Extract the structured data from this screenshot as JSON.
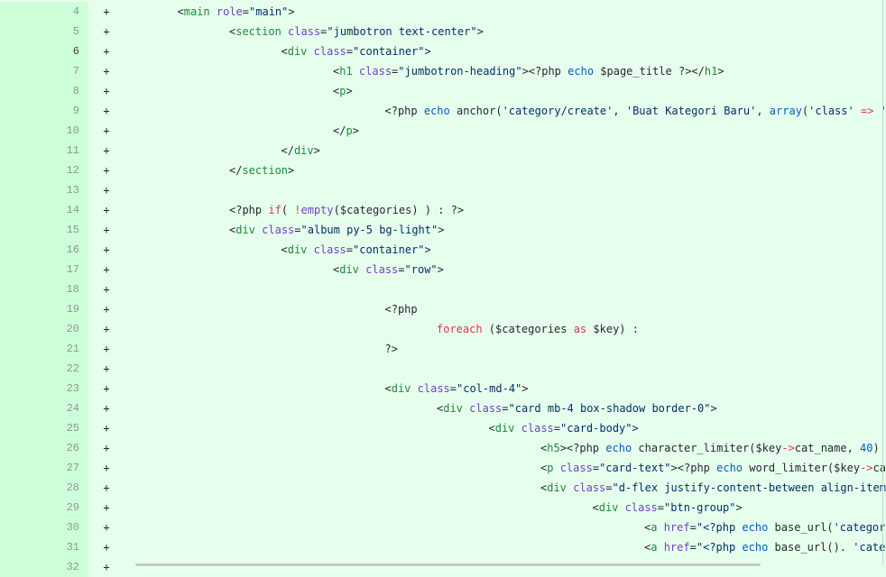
{
  "diff": {
    "lines": [
      {
        "num": "4",
        "marker": "+",
        "indent": 1,
        "tokens": [
          {
            "t": "<",
            "c": "text"
          },
          {
            "t": "main",
            "c": "tag"
          },
          {
            "t": " ",
            "c": "text"
          },
          {
            "t": "role",
            "c": "attr"
          },
          {
            "t": "=",
            "c": "text"
          },
          {
            "t": "\"main\"",
            "c": "str"
          },
          {
            "t": ">",
            "c": "text"
          }
        ]
      },
      {
        "num": "5",
        "marker": "+",
        "indent": 2,
        "tokens": [
          {
            "t": "<",
            "c": "text"
          },
          {
            "t": "section",
            "c": "tag"
          },
          {
            "t": " ",
            "c": "text"
          },
          {
            "t": "class",
            "c": "attr"
          },
          {
            "t": "=",
            "c": "text"
          },
          {
            "t": "\"jumbotron text-center\"",
            "c": "str"
          },
          {
            "t": ">",
            "c": "text"
          }
        ]
      },
      {
        "num": "6",
        "marker": "+",
        "indent": 3,
        "current": true,
        "tokens": [
          {
            "t": "<",
            "c": "text"
          },
          {
            "t": "div",
            "c": "tag"
          },
          {
            "t": " ",
            "c": "text"
          },
          {
            "t": "class",
            "c": "attr"
          },
          {
            "t": "=",
            "c": "text"
          },
          {
            "t": "\"container\"",
            "c": "str"
          },
          {
            "t": ">",
            "c": "text"
          }
        ]
      },
      {
        "num": "7",
        "marker": "+",
        "indent": 4,
        "tokens": [
          {
            "t": "<",
            "c": "text"
          },
          {
            "t": "h1",
            "c": "tag"
          },
          {
            "t": " ",
            "c": "text"
          },
          {
            "t": "class",
            "c": "attr"
          },
          {
            "t": "=",
            "c": "text"
          },
          {
            "t": "\"jumbotron-heading\"",
            "c": "str"
          },
          {
            "t": "><?php ",
            "c": "text"
          },
          {
            "t": "echo",
            "c": "kw"
          },
          {
            "t": " $page_title ?></",
            "c": "text"
          },
          {
            "t": "h1",
            "c": "tag"
          },
          {
            "t": ">",
            "c": "text"
          }
        ]
      },
      {
        "num": "8",
        "marker": "+",
        "indent": 4,
        "tokens": [
          {
            "t": "<",
            "c": "text"
          },
          {
            "t": "p",
            "c": "tag"
          },
          {
            "t": ">",
            "c": "text"
          }
        ]
      },
      {
        "num": "9",
        "marker": "+",
        "indent": 5,
        "tokens": [
          {
            "t": "<?php ",
            "c": "text"
          },
          {
            "t": "echo",
            "c": "kw"
          },
          {
            "t": " anchor(",
            "c": "text"
          },
          {
            "t": "'category/create'",
            "c": "str"
          },
          {
            "t": ", ",
            "c": "text"
          },
          {
            "t": "'Buat Kategori Baru'",
            "c": "str"
          },
          {
            "t": ", ",
            "c": "text"
          },
          {
            "t": "array",
            "c": "kw"
          },
          {
            "t": "(",
            "c": "text"
          },
          {
            "t": "'class'",
            "c": "str"
          },
          {
            "t": " ",
            "c": "text"
          },
          {
            "t": "=>",
            "c": "key"
          },
          {
            "t": " ",
            "c": "text"
          },
          {
            "t": "'btn",
            "c": "str"
          }
        ]
      },
      {
        "num": "10",
        "marker": "+",
        "indent": 4,
        "tokens": [
          {
            "t": "</",
            "c": "text"
          },
          {
            "t": "p",
            "c": "tag"
          },
          {
            "t": ">",
            "c": "text"
          }
        ]
      },
      {
        "num": "11",
        "marker": "+",
        "indent": 3,
        "tokens": [
          {
            "t": "</",
            "c": "text"
          },
          {
            "t": "div",
            "c": "tag"
          },
          {
            "t": ">",
            "c": "text"
          }
        ]
      },
      {
        "num": "12",
        "marker": "+",
        "indent": 2,
        "tokens": [
          {
            "t": "</",
            "c": "text"
          },
          {
            "t": "section",
            "c": "tag"
          },
          {
            "t": ">",
            "c": "text"
          }
        ]
      },
      {
        "num": "13",
        "marker": "+",
        "indent": 0,
        "tokens": []
      },
      {
        "num": "14",
        "marker": "+",
        "indent": 2,
        "tokens": [
          {
            "t": "<?php ",
            "c": "text"
          },
          {
            "t": "if",
            "c": "key"
          },
          {
            "t": "( ",
            "c": "text"
          },
          {
            "t": "!",
            "c": "key"
          },
          {
            "t": "empty",
            "c": "attr"
          },
          {
            "t": "($categories) ) : ?>",
            "c": "text"
          }
        ]
      },
      {
        "num": "15",
        "marker": "+",
        "indent": 2,
        "tokens": [
          {
            "t": "<",
            "c": "text"
          },
          {
            "t": "div",
            "c": "tag"
          },
          {
            "t": " ",
            "c": "text"
          },
          {
            "t": "class",
            "c": "attr"
          },
          {
            "t": "=",
            "c": "text"
          },
          {
            "t": "\"album py-5 bg-light\"",
            "c": "str"
          },
          {
            "t": ">",
            "c": "text"
          }
        ]
      },
      {
        "num": "16",
        "marker": "+",
        "indent": 3,
        "tokens": [
          {
            "t": "<",
            "c": "text"
          },
          {
            "t": "div",
            "c": "tag"
          },
          {
            "t": " ",
            "c": "text"
          },
          {
            "t": "class",
            "c": "attr"
          },
          {
            "t": "=",
            "c": "text"
          },
          {
            "t": "\"container\"",
            "c": "str"
          },
          {
            "t": ">",
            "c": "text"
          }
        ]
      },
      {
        "num": "17",
        "marker": "+",
        "indent": 4,
        "tokens": [
          {
            "t": "<",
            "c": "text"
          },
          {
            "t": "div",
            "c": "tag"
          },
          {
            "t": " ",
            "c": "text"
          },
          {
            "t": "class",
            "c": "attr"
          },
          {
            "t": "=",
            "c": "text"
          },
          {
            "t": "\"row\"",
            "c": "str"
          },
          {
            "t": ">",
            "c": "text"
          }
        ]
      },
      {
        "num": "18",
        "marker": "+",
        "indent": 0,
        "tokens": []
      },
      {
        "num": "19",
        "marker": "+",
        "indent": 5,
        "tokens": [
          {
            "t": "<?php",
            "c": "text"
          }
        ]
      },
      {
        "num": "20",
        "marker": "+",
        "indent": 6,
        "tokens": [
          {
            "t": "foreach",
            "c": "key"
          },
          {
            "t": " ($categories ",
            "c": "text"
          },
          {
            "t": "as",
            "c": "key"
          },
          {
            "t": " $key) :",
            "c": "text"
          }
        ]
      },
      {
        "num": "21",
        "marker": "+",
        "indent": 5,
        "tokens": [
          {
            "t": "?>",
            "c": "text"
          }
        ]
      },
      {
        "num": "22",
        "marker": "+",
        "indent": 0,
        "tokens": []
      },
      {
        "num": "23",
        "marker": "+",
        "indent": 5,
        "tokens": [
          {
            "t": "<",
            "c": "text"
          },
          {
            "t": "div",
            "c": "tag"
          },
          {
            "t": " ",
            "c": "text"
          },
          {
            "t": "class",
            "c": "attr"
          },
          {
            "t": "=",
            "c": "text"
          },
          {
            "t": "\"col-md-4\"",
            "c": "str"
          },
          {
            "t": ">",
            "c": "text"
          }
        ]
      },
      {
        "num": "24",
        "marker": "+",
        "indent": 6,
        "tokens": [
          {
            "t": "<",
            "c": "text"
          },
          {
            "t": "div",
            "c": "tag"
          },
          {
            "t": " ",
            "c": "text"
          },
          {
            "t": "class",
            "c": "attr"
          },
          {
            "t": "=",
            "c": "text"
          },
          {
            "t": "\"card mb-4 box-shadow border-0\"",
            "c": "str"
          },
          {
            "t": ">",
            "c": "text"
          }
        ]
      },
      {
        "num": "25",
        "marker": "+",
        "indent": 7,
        "tokens": [
          {
            "t": "<",
            "c": "text"
          },
          {
            "t": "div",
            "c": "tag"
          },
          {
            "t": " ",
            "c": "text"
          },
          {
            "t": "class",
            "c": "attr"
          },
          {
            "t": "=",
            "c": "text"
          },
          {
            "t": "\"card-body\"",
            "c": "str"
          },
          {
            "t": ">",
            "c": "text"
          }
        ]
      },
      {
        "num": "26",
        "marker": "+",
        "indent": 8,
        "tokens": [
          {
            "t": "<",
            "c": "text"
          },
          {
            "t": "h5",
            "c": "tag"
          },
          {
            "t": "><?php ",
            "c": "text"
          },
          {
            "t": "echo",
            "c": "kw"
          },
          {
            "t": " character_limiter($key",
            "c": "text"
          },
          {
            "t": "->",
            "c": "key"
          },
          {
            "t": "cat_name, ",
            "c": "text"
          },
          {
            "t": "40",
            "c": "num"
          },
          {
            "t": ") ?></",
            "c": "text"
          }
        ]
      },
      {
        "num": "27",
        "marker": "+",
        "indent": 8,
        "tokens": [
          {
            "t": "<",
            "c": "text"
          },
          {
            "t": "p",
            "c": "tag"
          },
          {
            "t": " ",
            "c": "text"
          },
          {
            "t": "class",
            "c": "attr"
          },
          {
            "t": "=",
            "c": "text"
          },
          {
            "t": "\"card-text\"",
            "c": "str"
          },
          {
            "t": "><?php ",
            "c": "text"
          },
          {
            "t": "echo",
            "c": "kw"
          },
          {
            "t": " word_limiter($key",
            "c": "text"
          },
          {
            "t": "->",
            "c": "key"
          },
          {
            "t": "cat_de",
            "c": "text"
          }
        ]
      },
      {
        "num": "28",
        "marker": "+",
        "indent": 8,
        "tokens": [
          {
            "t": "<",
            "c": "text"
          },
          {
            "t": "div",
            "c": "tag"
          },
          {
            "t": " ",
            "c": "text"
          },
          {
            "t": "class",
            "c": "attr"
          },
          {
            "t": "=",
            "c": "text"
          },
          {
            "t": "\"d-flex justify-content-between align-items-ce",
            "c": "str"
          }
        ]
      },
      {
        "num": "29",
        "marker": "+",
        "indent": 9,
        "tokens": [
          {
            "t": "<",
            "c": "text"
          },
          {
            "t": "div",
            "c": "tag"
          },
          {
            "t": " ",
            "c": "text"
          },
          {
            "t": "class",
            "c": "attr"
          },
          {
            "t": "=",
            "c": "text"
          },
          {
            "t": "\"btn-group\"",
            "c": "str"
          },
          {
            "t": ">",
            "c": "text"
          }
        ]
      },
      {
        "num": "30",
        "marker": "+",
        "indent": 10,
        "tokens": [
          {
            "t": "<",
            "c": "text"
          },
          {
            "t": "a",
            "c": "tag"
          },
          {
            "t": " ",
            "c": "text"
          },
          {
            "t": "href",
            "c": "attr"
          },
          {
            "t": "=",
            "c": "text"
          },
          {
            "t": "\"<?php ",
            "c": "str"
          },
          {
            "t": "echo",
            "c": "kw"
          },
          {
            "t": " base_url(",
            "c": "text"
          },
          {
            "t": "'category/'",
            "c": "str"
          },
          {
            "t": ".",
            "c": "text"
          }
        ]
      },
      {
        "num": "31",
        "marker": "+",
        "indent": 10,
        "tokens": [
          {
            "t": "<",
            "c": "text"
          },
          {
            "t": "a",
            "c": "tag"
          },
          {
            "t": " ",
            "c": "text"
          },
          {
            "t": "href",
            "c": "attr"
          },
          {
            "t": "=",
            "c": "text"
          },
          {
            "t": "\"<?php ",
            "c": "str"
          },
          {
            "t": "echo",
            "c": "kw"
          },
          {
            "t": " base_url(). ",
            "c": "text"
          },
          {
            "t": "'category",
            "c": "str"
          }
        ]
      },
      {
        "num": "32",
        "marker": "+",
        "indent": 0,
        "tokens": []
      }
    ]
  }
}
